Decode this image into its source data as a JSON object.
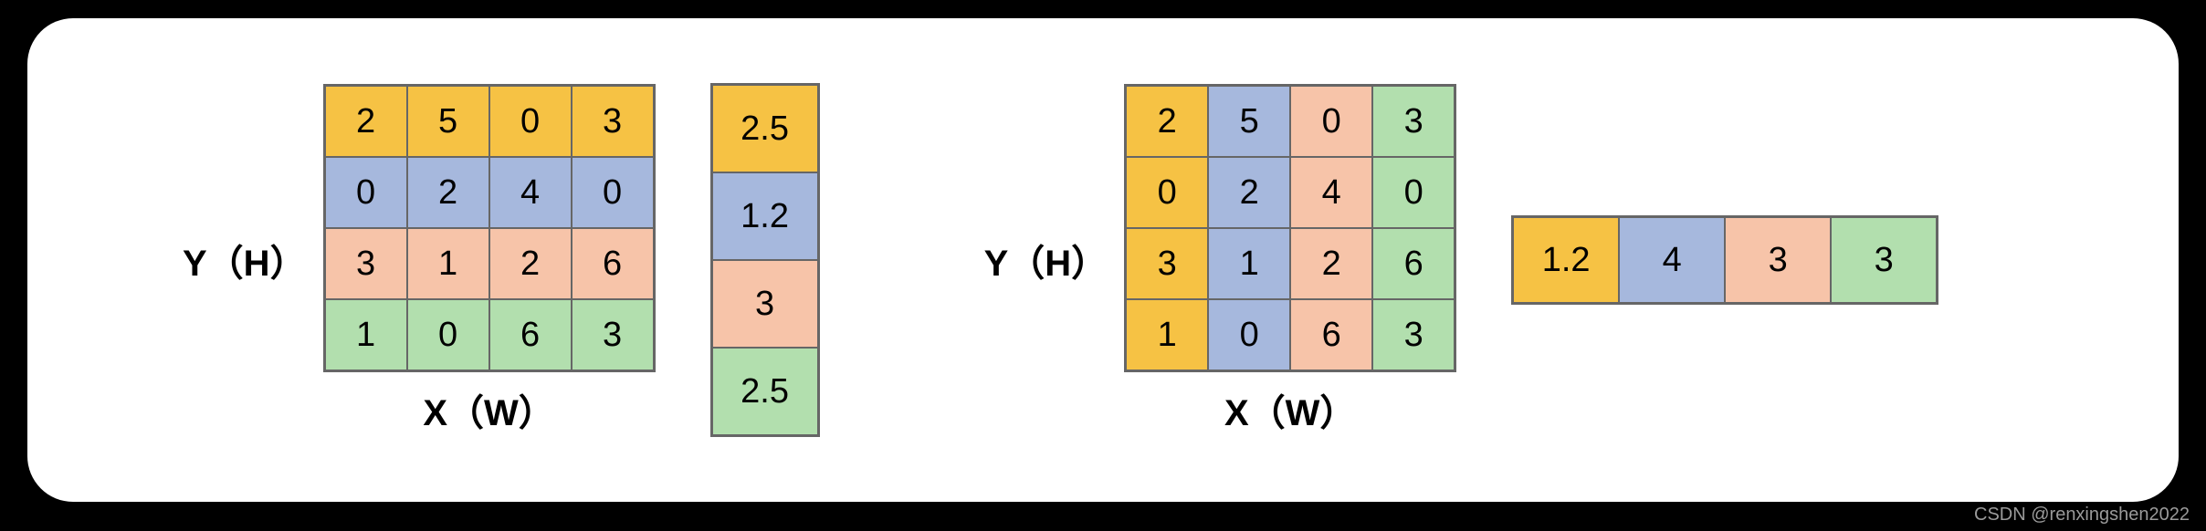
{
  "labels": {
    "y": "Y（H）",
    "x": "X（W）"
  },
  "colors": {
    "yellow": "#f6c244",
    "blue": "#a6b8dd",
    "peach": "#f7c4a9",
    "green": "#b2dfae"
  },
  "left_matrix": {
    "rows": [
      {
        "color": "yellow",
        "values": [
          "2",
          "5",
          "0",
          "3"
        ]
      },
      {
        "color": "blue",
        "values": [
          "0",
          "2",
          "4",
          "0"
        ]
      },
      {
        "color": "peach",
        "values": [
          "3",
          "1",
          "2",
          "6"
        ]
      },
      {
        "color": "green",
        "values": [
          "1",
          "0",
          "6",
          "3"
        ]
      }
    ]
  },
  "left_result_vector": {
    "orientation": "vertical",
    "cells": [
      {
        "color": "yellow",
        "value": "2.5"
      },
      {
        "color": "blue",
        "value": "1.2"
      },
      {
        "color": "peach",
        "value": "3"
      },
      {
        "color": "green",
        "value": "2.5"
      }
    ]
  },
  "right_matrix": {
    "cols": [
      {
        "color": "yellow",
        "values": [
          "2",
          "0",
          "3",
          "1"
        ]
      },
      {
        "color": "blue",
        "values": [
          "5",
          "2",
          "1",
          "0"
        ]
      },
      {
        "color": "peach",
        "values": [
          "0",
          "4",
          "2",
          "6"
        ]
      },
      {
        "color": "green",
        "values": [
          "3",
          "0",
          "6",
          "3"
        ]
      }
    ]
  },
  "right_result_vector": {
    "orientation": "horizontal",
    "cells": [
      {
        "color": "yellow",
        "value": "1.2"
      },
      {
        "color": "blue",
        "value": "4"
      },
      {
        "color": "peach",
        "value": "3"
      },
      {
        "color": "green",
        "value": "3"
      }
    ]
  },
  "watermark": "CSDN @renxingshen2022",
  "chart_data": {
    "type": "table",
    "description": "Two 4x4 matrices with row-wise and column-wise aggregation vectors",
    "matrix_values": [
      [
        2,
        5,
        0,
        3
      ],
      [
        0,
        2,
        4,
        0
      ],
      [
        3,
        1,
        2,
        6
      ],
      [
        1,
        0,
        6,
        3
      ]
    ],
    "row_result": [
      2.5,
      1.2,
      3,
      2.5
    ],
    "col_result": [
      1.2,
      4,
      3,
      3
    ]
  }
}
